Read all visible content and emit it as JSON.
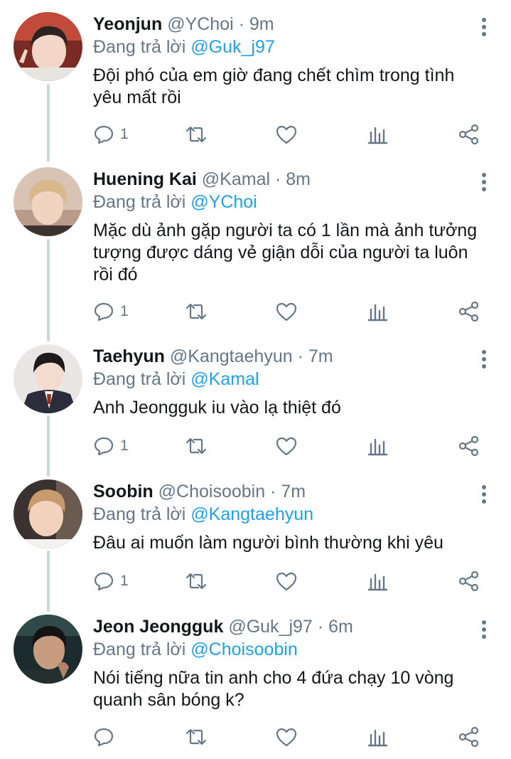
{
  "reply_prefix": "Đang trả lời",
  "colors": {
    "accent": "#1da1f2",
    "muted": "#657786",
    "text": "#14171a",
    "thread": "#ccd6dd"
  },
  "icons": {
    "reply": "comment-icon",
    "retweet": "retweet-icon",
    "like": "heart-icon",
    "views": "analytics-icon",
    "share": "share-icon",
    "menu": "more-vertical-icon"
  },
  "tweets": [
    {
      "name": "Yeonjun",
      "handle": "@YChoi",
      "sep": "·",
      "time": "9m",
      "reply_to": "@Guk_j97",
      "lines": [
        "Đội phó của em giờ đang chết chìm trong tình",
        "yêu mất rồi"
      ],
      "reply_count": "1"
    },
    {
      "name": "Huening Kai",
      "handle": "@Kamal",
      "sep": "·",
      "time": "8m",
      "reply_to": "@YChoi",
      "lines": [
        "Mặc dù ảnh gặp người ta có 1 lần mà ảnh tưởng",
        "tượng được dáng vẻ giận dỗi của người ta luôn",
        "rồi đó"
      ],
      "reply_count": "1"
    },
    {
      "name": "Taehyun",
      "handle": "@Kangtaehyun",
      "sep": "·",
      "time": "7m",
      "reply_to": "@Kamal",
      "lines": [
        "Anh Jeongguk iu vào lạ thiệt đó"
      ],
      "reply_count": "1"
    },
    {
      "name": "Soobin",
      "handle": "@Choisoobin",
      "sep": "·",
      "time": "7m",
      "reply_to": "@Kangtaehyun",
      "lines": [
        "Đâu ai muốn làm người bình thường khi yêu"
      ],
      "reply_count": "1"
    },
    {
      "name": "Jeon Jeongguk",
      "handle": "@Guk_j97",
      "sep": "·",
      "time": "6m",
      "reply_to": "@Choisoobin",
      "lines": [
        "Nói tiếng nữa tin anh cho 4 đứa chạy 10 vòng",
        "quanh sân bóng k?"
      ],
      "reply_count": ""
    }
  ]
}
